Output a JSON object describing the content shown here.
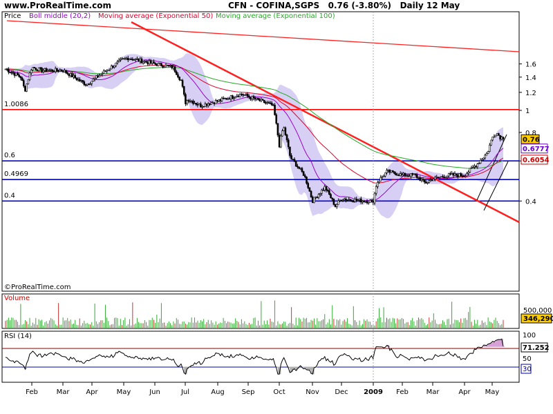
{
  "site": "www.ProRealTime.com",
  "title": "CFN - COFINA,SGPS",
  "quote": "0.76 (-3.80%)",
  "period": "Daily 12 May",
  "copyright": "©ProRealTime.com",
  "legend": {
    "price": "Price",
    "boll": "Boll middle (20,2)",
    "ema50": "Moving average (Exponential 50)",
    "ema100": "Moving average (Exponential 100)"
  },
  "colors": {
    "candles": "#000000",
    "bollinger_band": "#d8d0f4",
    "boll_middle": "#9900cc",
    "ema50": "#e0002a",
    "ema100": "#22aa22",
    "horizontal_red": "#ff0000",
    "horizontal_blue": "#0000dd",
    "trend_red": "#ff2020",
    "volume": "#33aa33",
    "rsi_line": "#000000"
  },
  "chart_data": [
    {
      "type": "candlestick",
      "panel": "price",
      "x_tick_labels": [
        "Feb",
        "Mar",
        "Apr",
        "May",
        "Jun",
        "Jul",
        "Aug",
        "Sep",
        "Oct",
        "Nov",
        "Dec",
        "2009",
        "Feb",
        "Mar",
        "Apr",
        "May"
      ],
      "y_ticks": [
        0.4,
        0.6,
        0.8,
        1,
        1.2,
        1.4,
        1.6
      ],
      "y_tick_labels": [
        "0.4",
        "0.6",
        "0.8",
        "1",
        "1.2",
        "1.4",
        "1.6"
      ],
      "ylim": [
        0.31,
        1.76
      ],
      "scale": "log",
      "grid": false,
      "legend_placement": "top-left",
      "last_close": 0.76,
      "change_pct": -3.8,
      "series": [
        {
          "name": "Price",
          "kind": "candles",
          "monthly_close_approx": [
            1.55,
            1.5,
            1.35,
            1.68,
            1.6,
            1.08,
            1.1,
            1.15,
            0.7,
            0.4,
            0.41,
            0.4,
            0.52,
            0.5,
            0.52,
            0.76
          ]
        },
        {
          "name": "Boll middle (20,2)",
          "kind": "line",
          "last_value": 0.6777
        },
        {
          "name": "Moving average (Exponential 50)",
          "kind": "line",
          "last_value": 0.6054
        },
        {
          "name": "Moving average (Exponential 100)",
          "kind": "line"
        }
      ],
      "horizontal_lines": [
        {
          "value": 1.0086,
          "label": "1.0086",
          "color": "red"
        },
        {
          "value": 0.6,
          "label": "0.6",
          "color": "blue"
        },
        {
          "value": 0.4969,
          "label": "0.4969",
          "color": "blue"
        },
        {
          "value": 0.4,
          "label": "0.4",
          "color": "blue"
        }
      ],
      "value_tags": [
        {
          "label": "0.76",
          "value": 0.76
        },
        {
          "label": "0.6777",
          "value": 0.6777
        },
        {
          "label": "0.6054",
          "value": 0.6054
        }
      ]
    },
    {
      "type": "bar",
      "panel": "volume",
      "title": "Volume",
      "y_tick_labels": [
        "500,000"
      ],
      "last_value": 346290,
      "last_value_label": "346,290"
    },
    {
      "type": "line",
      "panel": "rsi",
      "title": "RSI (14)",
      "y_ticks": [
        50,
        100
      ],
      "y_tick_labels": [
        "50",
        "100"
      ],
      "ylim": [
        0,
        100
      ],
      "guide_lines": [
        70,
        30
      ],
      "last_value": 71.252,
      "last_value_label": "71.252",
      "level_tag": "30"
    }
  ]
}
